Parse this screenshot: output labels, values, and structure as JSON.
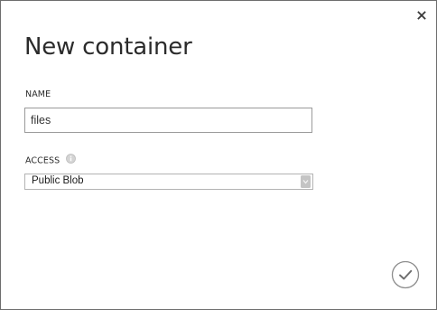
{
  "dialog": {
    "title": "New container",
    "close_icon": "close-icon",
    "confirm_icon": "checkmark-icon"
  },
  "form": {
    "name_label": "NAME",
    "name_value": "files",
    "access_label": "ACCESS",
    "access_info_icon": "info-icon",
    "access_value": "Public Blob",
    "access_dropdown_icon": "chevron-down-icon"
  }
}
